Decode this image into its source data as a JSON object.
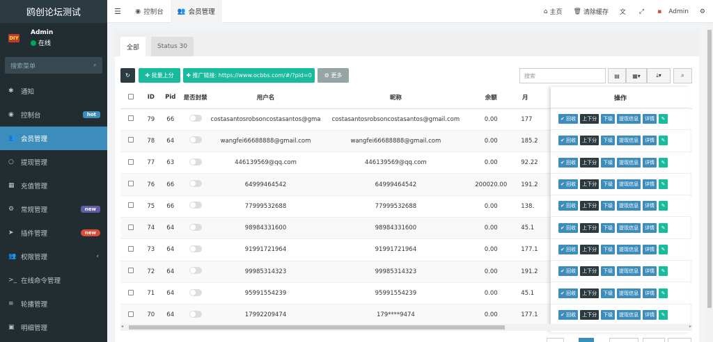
{
  "brand": "鸥创论坛测试",
  "user": {
    "name": "Admin",
    "status": "在线",
    "avatar_text": "DIY"
  },
  "sidebar": {
    "search_placeholder": "搜索菜单",
    "items": [
      {
        "icon": "✱",
        "label": "通知"
      },
      {
        "icon": "◉",
        "label": "控制台",
        "badge": "hot"
      },
      {
        "icon": "👥",
        "label": "会员管理",
        "active": true
      },
      {
        "icon": "○",
        "label": "提现管理"
      },
      {
        "icon": "▦",
        "label": "充值管理"
      },
      {
        "icon": "⚙",
        "label": "常规管理",
        "badge": "new"
      },
      {
        "icon": "➤",
        "label": "插件管理",
        "badge": "new"
      },
      {
        "icon": "👥",
        "label": "权限管理",
        "chevron": "‹"
      },
      {
        "icon": ">_",
        "label": "在线命令管理"
      },
      {
        "icon": "≡",
        "label": "轮播管理"
      },
      {
        "icon": "▣",
        "label": "明细管理"
      }
    ]
  },
  "topbar": {
    "tabs": [
      {
        "icon": "◉",
        "label": "控制台"
      },
      {
        "icon": "👥",
        "label": "会员管理"
      }
    ],
    "right": [
      {
        "icon": "⌂",
        "label": "主页"
      },
      {
        "icon": "🗑",
        "label": "清除缓存"
      },
      {
        "icon": "文",
        "label": ""
      },
      {
        "icon": "⤢",
        "label": ""
      },
      {
        "icon": "▪",
        "label": "Admin"
      },
      {
        "icon": "⚙",
        "label": ""
      }
    ]
  },
  "tabs": {
    "all": "全部",
    "status": "Status 30"
  },
  "toolbar": {
    "refresh": "↻",
    "batch": "✚ 批量上分",
    "promo": "✚ 推广链接: https://www.ocbbs.com/#/?pid=0",
    "more": "⚙ 更多",
    "search_placeholder": "搜索"
  },
  "table": {
    "headers": [
      "ID",
      "Pid",
      "是否封禁",
      "用户名",
      "昵称",
      "余额",
      "月"
    ],
    "rows": [
      [
        "79",
        "66",
        "costasantosrobsoncostasantos@gma",
        "costasantosrobsoncostasantos@gmail.com",
        "0.00",
        "177"
      ],
      [
        "78",
        "64",
        "wangfei66688888@gmail.com",
        "wangfei66688888@gmail.com",
        "0.00",
        "185.2"
      ],
      [
        "77",
        "63",
        "446139569@qq.com",
        "446139569@qq.com",
        "0.00",
        "92.22"
      ],
      [
        "76",
        "66",
        "64999464542",
        "64999464542",
        "200020.00",
        "191.2"
      ],
      [
        "75",
        "66",
        "77999532688",
        "77999532688",
        "0.00",
        "138."
      ],
      [
        "74",
        "64",
        "98984331600",
        "98984331600",
        "0.00",
        "45.1"
      ],
      [
        "73",
        "64",
        "91991721964",
        "91991721964",
        "0.00",
        "177.1"
      ],
      [
        "72",
        "64",
        "99985314323",
        "99985314323",
        "0.00",
        "191.2"
      ],
      [
        "71",
        "64",
        "95991554239",
        "95991554239",
        "0.00",
        "45.1"
      ],
      [
        "70",
        "64",
        "17992209474",
        "179****9474",
        "0.00",
        "177.1"
      ]
    ]
  },
  "ops": {
    "header": "操作",
    "buttons": [
      "✔ 回收",
      "上下分",
      "下级",
      "提现信息",
      "详情",
      "✎"
    ]
  }
}
